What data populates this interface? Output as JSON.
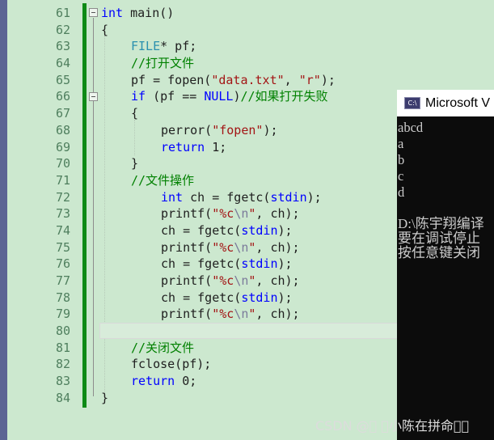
{
  "editor": {
    "line_numbers": [
      "61",
      "62",
      "63",
      "64",
      "65",
      "66",
      "67",
      "68",
      "69",
      "70",
      "71",
      "72",
      "73",
      "74",
      "75",
      "76",
      "77",
      "78",
      "79",
      "80",
      "81",
      "82",
      "83",
      "84"
    ],
    "lines": [
      {
        "type": "int ",
        "rest": "main()"
      },
      {
        "text": "{"
      },
      {
        "type": "FILE",
        "rest": "* pf;"
      },
      {
        "comment": "//打开文件"
      },
      {
        "pre": "pf = fopen(",
        "str1": "\"data.txt\"",
        "mid": ", ",
        "str2": "\"r\"",
        "post": ");"
      },
      {
        "kw": "if",
        "pre": " (pf == ",
        "macro": "NULL",
        "post": ")",
        "comment": "//如果打开失败"
      },
      {
        "text": "{"
      },
      {
        "pre": "perror(",
        "str1": "\"fopen\"",
        "post": ");"
      },
      {
        "kw": "return",
        "post": " 1;"
      },
      {
        "text": "}"
      },
      {
        "comment": "//文件操作"
      },
      {
        "kw": "int",
        "pre": " ch = fgetc(",
        "macro": "stdin",
        "post": ");"
      },
      {
        "pre": "printf(",
        "str1": "\"%c",
        "esc": "\\n",
        "str2": "\"",
        "post": ", ch);"
      },
      {
        "pre": "ch = fgetc(",
        "macro": "stdin",
        "post": ");"
      },
      {
        "pre": "printf(",
        "str1": "\"%c",
        "esc": "\\n",
        "str2": "\"",
        "post": ", ch);"
      },
      {
        "pre": "ch = fgetc(",
        "macro": "stdin",
        "post": ");"
      },
      {
        "pre": "printf(",
        "str1": "\"%c",
        "esc": "\\n",
        "str2": "\"",
        "post": ", ch);"
      },
      {
        "pre": "ch = fgetc(",
        "macro": "stdin",
        "post": ");"
      },
      {
        "pre": "printf(",
        "str1": "\"%c",
        "esc": "\\n",
        "str2": "\"",
        "post": ", ch);"
      },
      {
        "text": ""
      },
      {
        "comment": "//关闭文件"
      },
      {
        "pre": "fclose(pf);"
      },
      {
        "kw": "return",
        "post": " 0;"
      },
      {
        "text": "}"
      }
    ]
  },
  "console": {
    "icon": "console-app-icon",
    "icon_text": "C:\\",
    "title": "Microsoft V",
    "output": [
      "abcd",
      "a",
      "b",
      "c",
      "d",
      "",
      "D:\\陈宇翔编译",
      "要在调试停止",
      "按任意键关闭"
    ]
  },
  "watermark": "CSDN @\u0000 \u0000小陈在拼命\u0000\u0000",
  "colors": {
    "editor_bg": "#cce8cf",
    "keyword": "#0000ff",
    "string": "#a31515",
    "comment": "#008000",
    "type": "#2b91af",
    "change_bar": "#0e8a16",
    "console_bg": "#0c0c0c"
  }
}
